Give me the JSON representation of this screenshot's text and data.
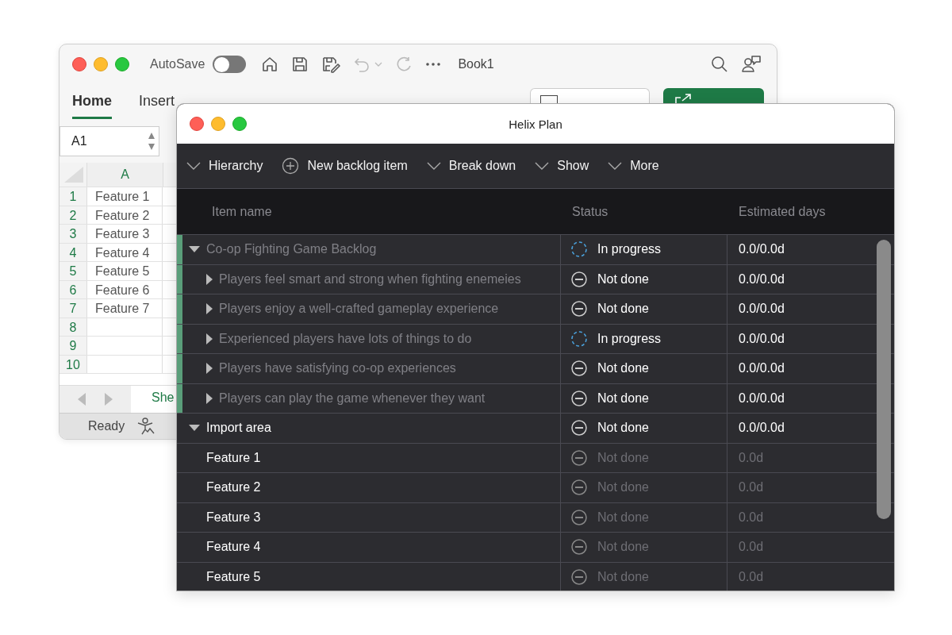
{
  "back_window": {
    "title": "Book1",
    "autosave": {
      "label": "AutoSave",
      "on": false
    },
    "tabs": [
      {
        "label": "Home",
        "selected": true
      },
      {
        "label": "Insert",
        "selected": false
      }
    ],
    "name_box": "A1",
    "sheet": {
      "column": "A",
      "rows": [
        {
          "number": "1",
          "cell": "Feature 1"
        },
        {
          "number": "2",
          "cell": "Feature 2"
        },
        {
          "number": "3",
          "cell": "Feature 3"
        },
        {
          "number": "4",
          "cell": "Feature 4"
        },
        {
          "number": "5",
          "cell": "Feature 5"
        },
        {
          "number": "6",
          "cell": "Feature 6"
        },
        {
          "number": "7",
          "cell": "Feature 7"
        },
        {
          "number": "8",
          "cell": ""
        },
        {
          "number": "9",
          "cell": ""
        },
        {
          "number": "10",
          "cell": ""
        }
      ]
    },
    "sheet_tab": "She",
    "status_bar": "Ready"
  },
  "window": {
    "title": "Helix Plan",
    "toolbar": [
      {
        "label": "Hierarchy",
        "kind": "menu"
      },
      {
        "label": "New backlog item",
        "kind": "add"
      },
      {
        "label": "Break down",
        "kind": "menu"
      },
      {
        "label": "Show",
        "kind": "menu"
      },
      {
        "label": "More",
        "kind": "menu"
      }
    ],
    "columns": [
      "Item name",
      "Status",
      "Estimated days"
    ],
    "rows": [
      {
        "name": "Co-op Fighting Game Backlog",
        "kind": "group",
        "expanded": true,
        "marked": true,
        "dimmed": true,
        "status": {
          "text": "In progress",
          "kind": "in_progress",
          "muted": false
        },
        "estimate": "0.0/0.0d",
        "children": [
          {
            "name": "Players feel smart and strong when fighting enemeies",
            "kind": "group",
            "expanded": false,
            "marked": true,
            "dimmed": true,
            "status": {
              "text": "Not done",
              "kind": "not_done",
              "muted": false
            },
            "estimate": "0.0/0.0d"
          },
          {
            "name": "Players enjoy a well-crafted gameplay experience",
            "kind": "group",
            "expanded": false,
            "marked": true,
            "dimmed": true,
            "status": {
              "text": "Not done",
              "kind": "not_done",
              "muted": false
            },
            "estimate": "0.0/0.0d"
          },
          {
            "name": "Experienced players have lots of things to do",
            "kind": "group",
            "expanded": false,
            "marked": true,
            "dimmed": true,
            "status": {
              "text": "In progress",
              "kind": "in_progress",
              "muted": false
            },
            "estimate": "0.0/0.0d"
          },
          {
            "name": "Players have satisfying co-op experiences",
            "kind": "group",
            "expanded": false,
            "marked": true,
            "dimmed": true,
            "status": {
              "text": "Not done",
              "kind": "not_done",
              "muted": false
            },
            "estimate": "0.0/0.0d"
          },
          {
            "name": "Players can play the game whenever they want",
            "kind": "group",
            "expanded": false,
            "marked": true,
            "dimmed": true,
            "status": {
              "text": "Not done",
              "kind": "not_done",
              "muted": false
            },
            "estimate": "0.0/0.0d"
          }
        ]
      },
      {
        "name": "Import area",
        "kind": "group",
        "expanded": true,
        "marked": false,
        "dimmed": false,
        "status": {
          "text": "Not done",
          "kind": "not_done",
          "muted": false
        },
        "estimate": "0.0/0.0d",
        "children": [
          {
            "name": "Feature 1",
            "kind": "item",
            "marked": false,
            "dimmed": false,
            "status": {
              "text": "Not done",
              "kind": "not_done",
              "muted": true
            },
            "estimate": "0.0d"
          },
          {
            "name": "Feature 2",
            "kind": "item",
            "marked": false,
            "dimmed": false,
            "status": {
              "text": "Not done",
              "kind": "not_done",
              "muted": true
            },
            "estimate": "0.0d"
          },
          {
            "name": "Feature 3",
            "kind": "item",
            "marked": false,
            "dimmed": false,
            "status": {
              "text": "Not done",
              "kind": "not_done",
              "muted": true
            },
            "estimate": "0.0d"
          },
          {
            "name": "Feature 4",
            "kind": "item",
            "marked": false,
            "dimmed": false,
            "status": {
              "text": "Not done",
              "kind": "not_done",
              "muted": true
            },
            "estimate": "0.0d"
          },
          {
            "name": "Feature 5",
            "kind": "item",
            "marked": false,
            "dimmed": false,
            "status": {
              "text": "Not done",
              "kind": "not_done",
              "muted": true
            },
            "estimate": "0.0d"
          }
        ]
      }
    ]
  }
}
